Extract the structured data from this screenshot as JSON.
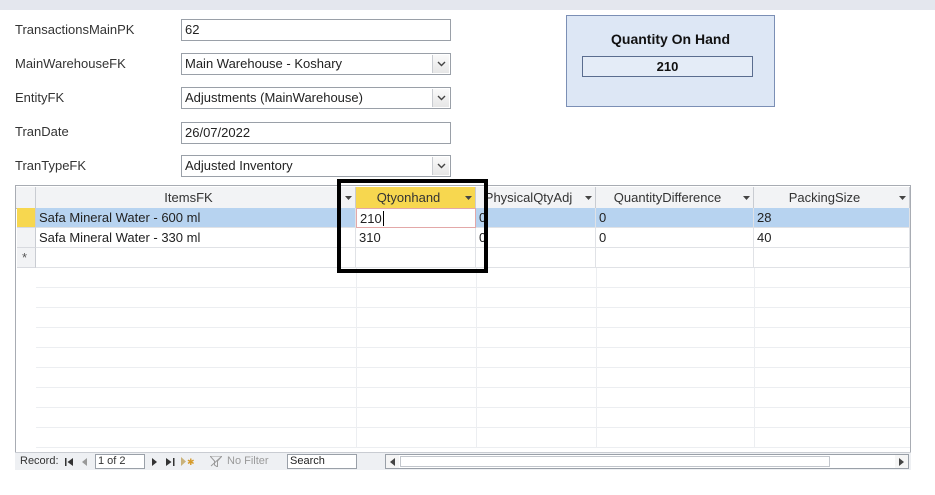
{
  "form": {
    "fields": [
      {
        "label": "TransactionsMainPK",
        "value": "62",
        "type": "text"
      },
      {
        "label": "MainWarehouseFK",
        "value": "Main Warehouse - Koshary",
        "type": "combo"
      },
      {
        "label": "EntityFK",
        "value": "Adjustments (MainWarehouse)",
        "type": "combo"
      },
      {
        "label": "TranDate",
        "value": "26/07/2022",
        "type": "text"
      },
      {
        "label": "TranTypeFK",
        "value": "Adjusted Inventory",
        "type": "combo"
      }
    ]
  },
  "qoh": {
    "title": "Quantity On Hand",
    "value": "210"
  },
  "grid": {
    "columns": [
      "ItemsFK",
      "Qtyonhand",
      "PhysicalQtyAdj",
      "QuantityDifference",
      "PackingSize"
    ],
    "active_column": "Qtyonhand",
    "rows": [
      [
        "Safa Mineral Water - 600 ml",
        "210",
        "0",
        "0",
        "28"
      ],
      [
        "Safa Mineral Water - 330 ml",
        "310",
        "0",
        "0",
        "40"
      ]
    ],
    "new_row_marker": "*"
  },
  "navigator": {
    "record_label": "Record:",
    "position": "1 of 2",
    "filter_label": "No Filter",
    "search_placeholder": "Search"
  },
  "colors": {
    "selected_row": "#b7d3f0",
    "active_header": "#f7d74f",
    "panel_bg": "#dde7f5"
  }
}
